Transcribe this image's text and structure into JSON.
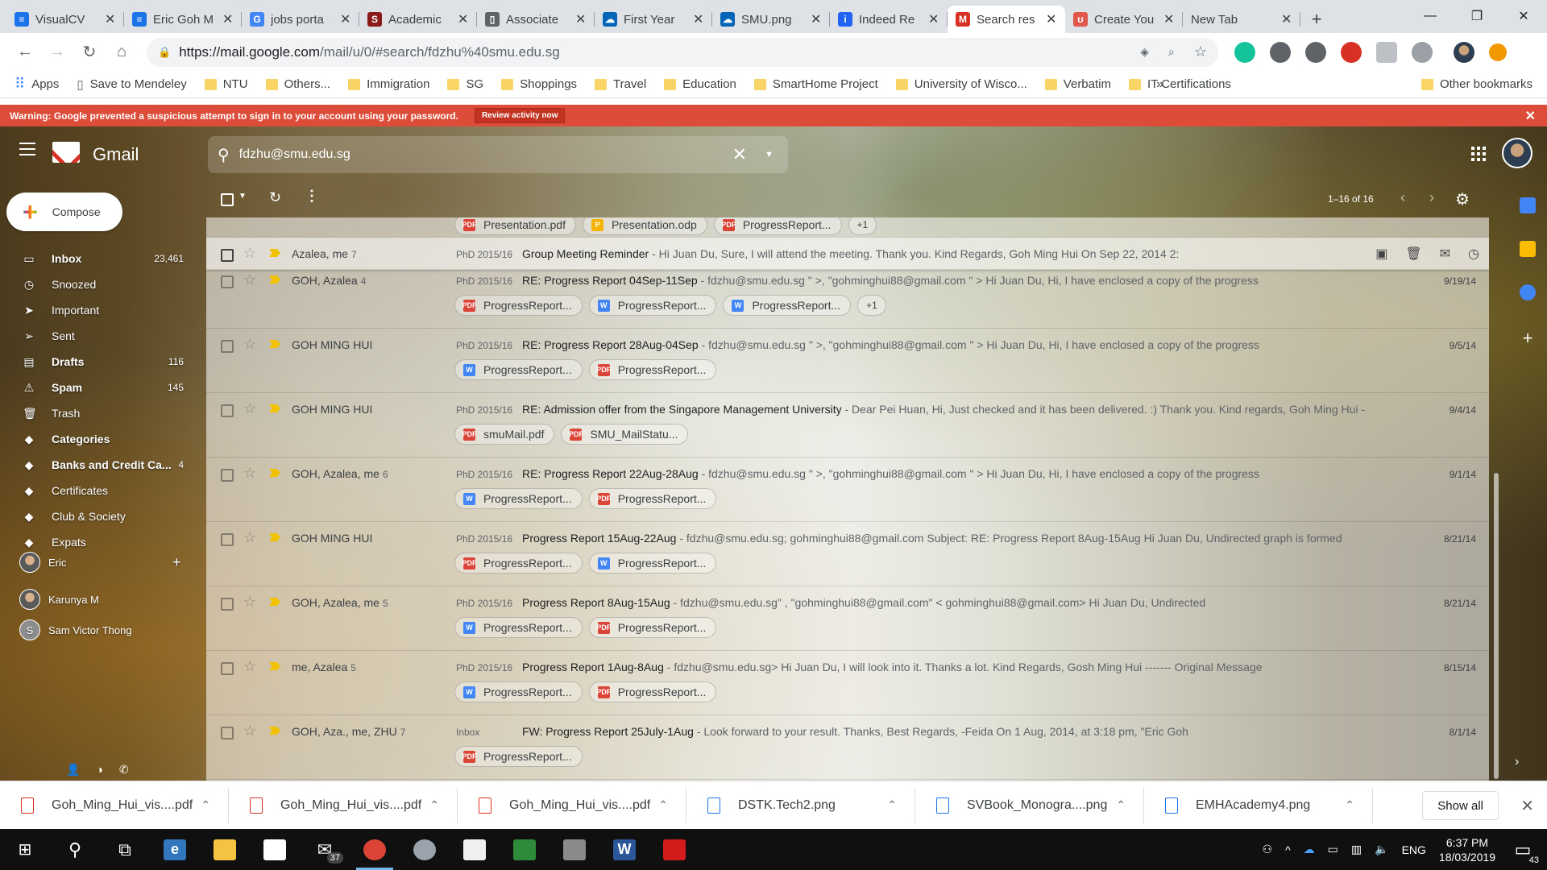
{
  "browser": {
    "tabs": [
      {
        "title": "VisualCV",
        "icon": "visualcv-favicon",
        "color": "#1a73e8",
        "glyph": "≡",
        "active": false
      },
      {
        "title": "Eric Goh M",
        "icon": "visualcv-favicon",
        "color": "#1a73e8",
        "glyph": "≡",
        "active": false
      },
      {
        "title": "jobs porta",
        "icon": "google-favicon",
        "color": "#4285f4",
        "glyph": "G",
        "active": false
      },
      {
        "title": "Academic",
        "icon": "smu-favicon",
        "color": "#8b1a1a",
        "glyph": "S",
        "active": false
      },
      {
        "title": "Associate",
        "icon": "document-favicon",
        "color": "#5f6368",
        "glyph": "▯",
        "active": false
      },
      {
        "title": "First Year",
        "icon": "onedrive-favicon",
        "color": "#0364b8",
        "glyph": "☁",
        "active": false
      },
      {
        "title": "SMU.png",
        "icon": "onedrive-favicon",
        "color": "#0364b8",
        "glyph": "☁",
        "active": false
      },
      {
        "title": "Indeed Re",
        "icon": "indeed-favicon",
        "color": "#2164f3",
        "glyph": "i",
        "active": false
      },
      {
        "title": "Search res",
        "icon": "gmail-favicon",
        "color": "#d93025",
        "glyph": "M",
        "active": true
      },
      {
        "title": "Create You",
        "icon": "create-favicon",
        "color": "#e0584b",
        "glyph": "ʊ",
        "active": false
      },
      {
        "title": "New Tab",
        "icon": "",
        "color": "transparent",
        "glyph": "",
        "active": false
      }
    ],
    "url_host": "https://mail.google.com",
    "url_path": "/mail/u/0/#search/fdzhu%40smu.edu.sg",
    "bookmarks": [
      {
        "label": "Apps",
        "type": "apps"
      },
      {
        "label": "Save to Mendeley",
        "type": "page"
      },
      {
        "label": "NTU",
        "type": "folder"
      },
      {
        "label": "Others...",
        "type": "folder"
      },
      {
        "label": "Immigration",
        "type": "folder"
      },
      {
        "label": "SG",
        "type": "folder"
      },
      {
        "label": "Shoppings",
        "type": "folder"
      },
      {
        "label": "Travel",
        "type": "folder"
      },
      {
        "label": "Education",
        "type": "folder"
      },
      {
        "label": "SmartHome Project",
        "type": "folder"
      },
      {
        "label": "University of Wisco...",
        "type": "folder"
      },
      {
        "label": "Verbatim",
        "type": "folder"
      },
      {
        "label": "IT Certifications",
        "type": "folder"
      }
    ],
    "bookmarks_more": "»",
    "other_bookmarks": "Other bookmarks"
  },
  "warning": {
    "text": "Warning: Google prevented a suspicious attempt to sign in to your account using your password.",
    "button": "Review activity now"
  },
  "gmail": {
    "brand": "Gmail",
    "search_query": "fdzhu@smu.edu.sg",
    "compose": "Compose",
    "pagination": "1–16 of 16",
    "labels": [
      {
        "name": "Inbox",
        "icon": "inbox-icon",
        "glyph": "▭",
        "count": "23,461",
        "bold": true
      },
      {
        "name": "Snoozed",
        "icon": "clock-icon",
        "glyph": "◷",
        "count": "",
        "bold": false
      },
      {
        "name": "Important",
        "icon": "important-icon",
        "glyph": "➤",
        "count": "",
        "bold": false
      },
      {
        "name": "Sent",
        "icon": "send-icon",
        "glyph": "➢",
        "count": "",
        "bold": false
      },
      {
        "name": "Drafts",
        "icon": "draft-icon",
        "glyph": "▤",
        "count": "116",
        "bold": true
      },
      {
        "name": "Spam",
        "icon": "spam-icon",
        "glyph": "⚠",
        "count": "145",
        "bold": true
      },
      {
        "name": "Trash",
        "icon": "trash-icon",
        "glyph": "🗑",
        "count": "",
        "bold": false
      },
      {
        "name": "Categories",
        "icon": "categories-icon",
        "glyph": "◆",
        "count": "",
        "bold": true
      },
      {
        "name": "Banks and Credit Ca...",
        "icon": "label-icon",
        "glyph": "◆",
        "count": "4",
        "bold": true
      },
      {
        "name": "Certificates",
        "icon": "label-icon",
        "glyph": "◆",
        "count": "",
        "bold": false
      },
      {
        "name": "Club & Society",
        "icon": "label-icon",
        "glyph": "◆",
        "count": "",
        "bold": false
      },
      {
        "name": "Expats",
        "icon": "label-icon",
        "glyph": "◆",
        "count": "",
        "bold": false
      }
    ],
    "chat_user": "Eric",
    "chat_contacts": [
      {
        "name": "Karunya M",
        "initial": ""
      },
      {
        "name": "Sam Victor Thong",
        "initial": "S"
      }
    ],
    "top_chips": [
      {
        "name": "Presentation.pdf",
        "type": "pdf"
      },
      {
        "name": "Presentation.odp",
        "type": "ppt"
      },
      {
        "name": "ProgressReport...",
        "type": "pdf"
      }
    ],
    "top_chips_more": "+1",
    "emails": [
      {
        "sender": "Azalea, me",
        "count": "7",
        "tag": "PhD 2015/16",
        "subject": "Group Meeting Reminder",
        "snippet": " - Hi Juan Du, Sure, I will attend the meeting. Thank you. Kind Regards, Goh Ming Hui On Sep 22, 2014 2:",
        "date": "",
        "hover": true,
        "attachments": [],
        "more": ""
      },
      {
        "sender": "GOH, Azalea",
        "count": "4",
        "tag": "PhD 2015/16",
        "subject": "RE: Progress Report 04Sep-11Sep",
        "snippet": " - fdzhu@smu.edu.sg \" >, \"gohminghui88@gmail.com \" > Hi Juan Du, Hi, I have enclosed a copy of the progress",
        "date": "9/19/14",
        "hover": false,
        "attachments": [
          {
            "name": "ProgressReport...",
            "type": "pdf"
          },
          {
            "name": "ProgressReport...",
            "type": "word"
          },
          {
            "name": "ProgressReport...",
            "type": "word"
          }
        ],
        "more": "+1"
      },
      {
        "sender": "GOH MING HUI",
        "count": "",
        "tag": "PhD 2015/16",
        "subject": "RE: Progress Report 28Aug-04Sep",
        "snippet": " - fdzhu@smu.edu.sg \" >, \"gohminghui88@gmail.com \" > Hi Juan Du, Hi, I have enclosed a copy of the progress",
        "date": "9/5/14",
        "hover": false,
        "attachments": [
          {
            "name": "ProgressReport...",
            "type": "word"
          },
          {
            "name": "ProgressReport...",
            "type": "pdf"
          }
        ],
        "more": ""
      },
      {
        "sender": "GOH MING HUI",
        "count": "",
        "tag": "PhD 2015/16",
        "subject": "RE: Admission offer from the Singapore Management University",
        "snippet": " - Dear Pei Huan, Hi, Just checked and it has been delivered. :) Thank you. Kind regards, Goh Ming Hui -",
        "date": "9/4/14",
        "hover": false,
        "attachments": [
          {
            "name": "smuMail.pdf",
            "type": "pdf"
          },
          {
            "name": "SMU_MailStatu...",
            "type": "pdf"
          }
        ],
        "more": ""
      },
      {
        "sender": "GOH, Azalea, me",
        "count": "6",
        "tag": "PhD 2015/16",
        "subject": "RE: Progress Report 22Aug-28Aug",
        "snippet": " - fdzhu@smu.edu.sg \" >, \"gohminghui88@gmail.com \" > Hi Juan Du, Hi, I have enclosed a copy of the progress",
        "date": "9/1/14",
        "hover": false,
        "attachments": [
          {
            "name": "ProgressReport...",
            "type": "word"
          },
          {
            "name": "ProgressReport...",
            "type": "pdf"
          }
        ],
        "more": ""
      },
      {
        "sender": "GOH MING HUI",
        "count": "",
        "tag": "PhD 2015/16",
        "subject": "Progress Report 15Aug-22Aug",
        "snippet": " - fdzhu@smu.edu.sg; gohminghui88@gmail.com Subject: RE: Progress Report 8Aug-15Aug Hi Juan Du, Undirected graph is formed",
        "date": "8/21/14",
        "hover": false,
        "attachments": [
          {
            "name": "ProgressReport...",
            "type": "pdf"
          },
          {
            "name": "ProgressReport...",
            "type": "word"
          }
        ],
        "more": ""
      },
      {
        "sender": "GOH, Azalea, me",
        "count": "5",
        "tag": "PhD 2015/16",
        "subject": "Progress Report 8Aug-15Aug",
        "snippet": " - fdzhu@smu.edu.sg\" , \"gohminghui88@gmail.com\" < gohminghui88@gmail.com> Hi Juan Du, Undirected",
        "date": "8/21/14",
        "hover": false,
        "attachments": [
          {
            "name": "ProgressReport...",
            "type": "word"
          },
          {
            "name": "ProgressReport...",
            "type": "pdf"
          }
        ],
        "more": ""
      },
      {
        "sender": "me, Azalea",
        "count": "5",
        "tag": "PhD 2015/16",
        "subject": "Progress Report 1Aug-8Aug",
        "snippet": " - fdzhu@smu.edu.sg> Hi Juan Du, I will look into it. Thanks a lot. Kind Regards, Gosh Ming Hui ------- Original Message",
        "date": "8/15/14",
        "hover": false,
        "attachments": [
          {
            "name": "ProgressReport...",
            "type": "word"
          },
          {
            "name": "ProgressReport...",
            "type": "pdf"
          }
        ],
        "more": ""
      },
      {
        "sender": "GOH, Aza., me, ZHU",
        "count": "7",
        "tag": "Inbox",
        "subject": "FW: Progress Report 25July-1Aug",
        "snippet": " - Look forward to your result. Thanks, Best Regards, -Feida On 1 Aug, 2014, at 3:18 pm, \"Eric Goh",
        "date": "8/1/14",
        "hover": false,
        "attachments": [
          {
            "name": "ProgressReport...",
            "type": "pdf"
          }
        ],
        "more": ""
      }
    ]
  },
  "downloads": {
    "items": [
      {
        "name": "Goh_Ming_Hui_vis....pdf",
        "type": "pdf"
      },
      {
        "name": "Goh_Ming_Hui_vis....pdf",
        "type": "pdf"
      },
      {
        "name": "Goh_Ming_Hui_vis....pdf",
        "type": "pdf"
      },
      {
        "name": "DSTK.Tech2.png",
        "type": "img"
      },
      {
        "name": "SVBook_Monogra....png",
        "type": "img"
      },
      {
        "name": "EMHAcademy4.png",
        "type": "img"
      }
    ],
    "show_all": "Show all"
  },
  "taskbar": {
    "apps": [
      {
        "name": "task-view",
        "glyph": "⧉",
        "color": "",
        "badge": ""
      },
      {
        "name": "edge",
        "glyph": "e",
        "color": "#3277bc",
        "badge": ""
      },
      {
        "name": "file-explorer",
        "glyph": "",
        "color": "#f5c342",
        "badge": ""
      },
      {
        "name": "store",
        "glyph": "",
        "color": "#ffffff",
        "badge": ""
      },
      {
        "name": "mail",
        "glyph": "✉",
        "color": "",
        "badge": "37"
      },
      {
        "name": "chrome",
        "glyph": "",
        "color": "#db4437",
        "badge": ""
      },
      {
        "name": "steam",
        "glyph": "",
        "color": "#9aa3ab",
        "badge": ""
      },
      {
        "name": "ide",
        "glyph": "",
        "color": "#f0f0f0",
        "badge": ""
      },
      {
        "name": "spreadsheet",
        "glyph": "",
        "color": "#2e8b3a",
        "badge": ""
      },
      {
        "name": "sd-tool",
        "glyph": "",
        "color": "#8a8a8a",
        "badge": ""
      },
      {
        "name": "word",
        "glyph": "W",
        "color": "#2b579a",
        "badge": ""
      },
      {
        "name": "acrobat",
        "glyph": "",
        "color": "#d31b1b",
        "badge": ""
      }
    ],
    "language": "ENG",
    "time": "6:37 PM",
    "date": "18/03/2019",
    "notifications": "43"
  }
}
